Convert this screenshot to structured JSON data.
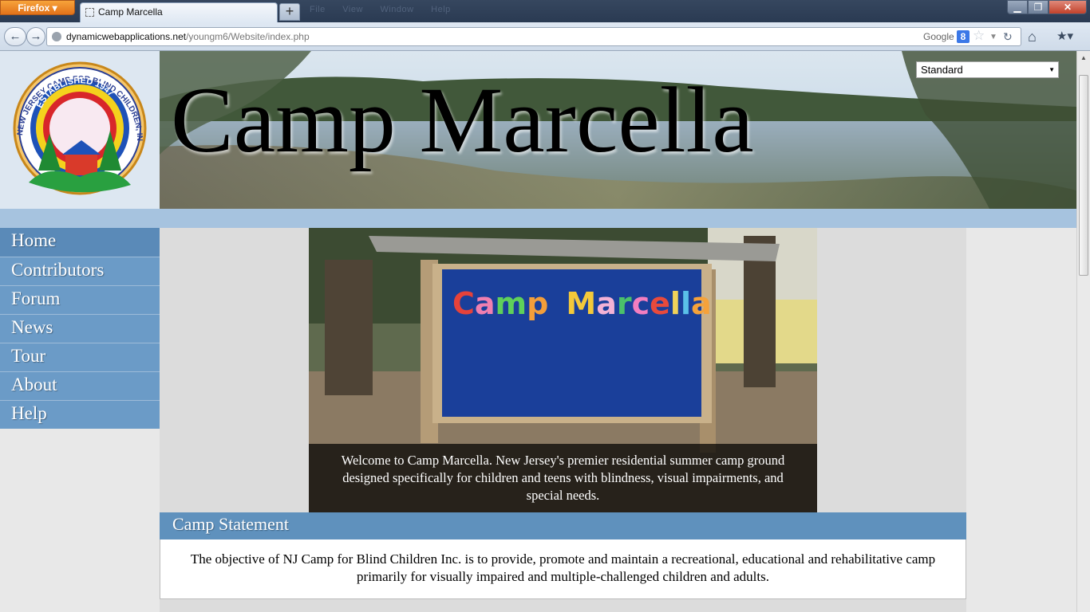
{
  "browser": {
    "menu_button_label": "Firefox ▾",
    "tab_title": "Camp Marcella",
    "new_tab_label": "+",
    "ghost_menu": "File View Window Help",
    "url_domain": "dynamicwebapplications.net",
    "url_path": "/youngm6/Website/index.php",
    "search_engine_label": "Google",
    "g_icon_label": "8",
    "minimize_label": "▁",
    "maximize_label": "❐",
    "close_label": "✕",
    "back_label": "←",
    "forward_label": "→",
    "star_label": "☆",
    "dropdown_label": "▼",
    "reload_label": "↻",
    "home_label": "⌂",
    "bookmarks_label": "★▾",
    "icons": [
      "back-arrow-icon",
      "forward-arrow-icon",
      "globe-icon",
      "google-icon",
      "star-icon",
      "reload-icon",
      "home-icon",
      "bookmarks-icon"
    ]
  },
  "header": {
    "site_title": "Camp Marcella",
    "logo_ring_text": "NEW JERSEY CAMP FOR BLIND CHILDREN, INC.",
    "logo_inner_text": "ESTABLISHED 1947",
    "style_select_value": "Standard"
  },
  "sidebar": {
    "items": [
      {
        "label": "Home"
      },
      {
        "label": "Contributors"
      },
      {
        "label": "Forum"
      },
      {
        "label": "News"
      },
      {
        "label": "Tour"
      },
      {
        "label": "About"
      },
      {
        "label": "Help"
      }
    ]
  },
  "main": {
    "sign_text": "Camp Marcella",
    "caption": "Welcome to Camp Marcella. New Jersey's premier residential summer camp ground designed specifically for children and teens with blindness, visual impairments, and special needs.",
    "statement_title": "Camp Statement",
    "statement_body": "The objective of NJ Camp for Blind Children Inc. is to provide, promote and maintain a recreational, educational and rehabilitative camp primarily for visually impaired and multiple-challenged children and adults."
  },
  "colors": {
    "nav_blue": "#6b9bc7",
    "nav_active": "#5a8ab8",
    "strip_blue": "#a6c3df",
    "header_blue": "#5f91bd",
    "sign_blue": "#1a3f9a"
  }
}
